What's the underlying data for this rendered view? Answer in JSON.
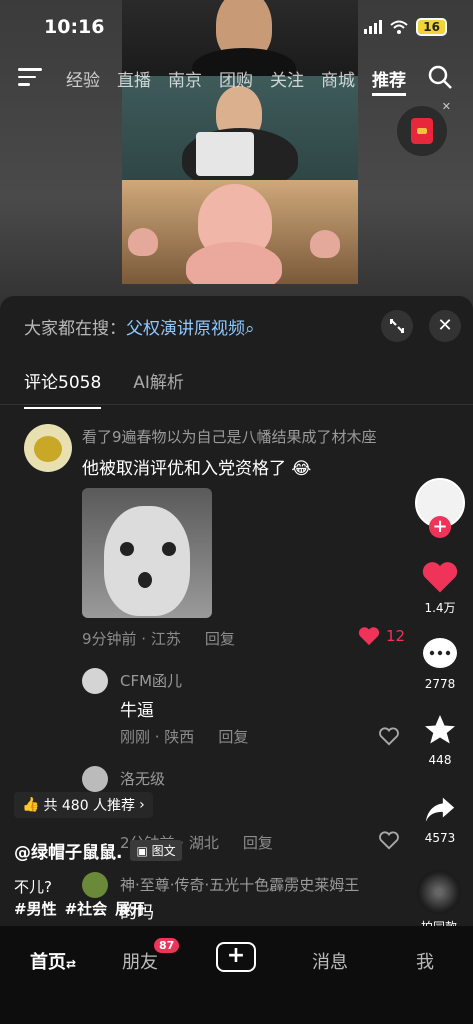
{
  "status": {
    "time": "10:16",
    "battery": "16"
  },
  "topnav": {
    "tabs": [
      "经验",
      "直播",
      "南京",
      "团购",
      "关注",
      "商城",
      "推荐"
    ],
    "active_tab": "推荐"
  },
  "panel": {
    "hot_search_prefix": "大家都在搜：",
    "hot_search_keyword": "父权演讲原视频",
    "tabs": {
      "comments": "评论5058",
      "ai": "AI解析"
    },
    "comments": [
      {
        "user": "看了9遍春物以为自己是八幡结果成了材木座",
        "text": "他被取消评优和入党资格了",
        "time_loc": "9分钟前 · 江苏",
        "reply": "回复",
        "likes": "12"
      },
      {
        "user": "CFM函儿",
        "text": "牛逼",
        "time_loc": "刚刚 · 陕西",
        "reply": "回复"
      },
      {
        "user": "洛无级",
        "time_loc": "2分钟前 · 湖北",
        "reply": "回复"
      },
      {
        "user": "神·至尊·传奇·五光十色霹雳史莱姆王",
        "text": "的吗"
      }
    ]
  },
  "side": {
    "likes": "1.4万",
    "comments": "2778",
    "favorites": "448",
    "shares": "4573"
  },
  "overlay": {
    "recommend": "共 480 人推荐",
    "author": "@绿帽子鼠鼠.",
    "tuwen": "图文",
    "caption1": "不儿?",
    "tags": [
      "#男性",
      "#社会"
    ],
    "expand": "展开",
    "music_label": "拍同款"
  },
  "bottomnav": {
    "home": "首页",
    "friends": "朋友",
    "friends_badge": "87",
    "messages": "消息",
    "me": "我"
  },
  "colors": {
    "like_red": "#f03358",
    "keyword_blue": "#8ec8ff"
  }
}
